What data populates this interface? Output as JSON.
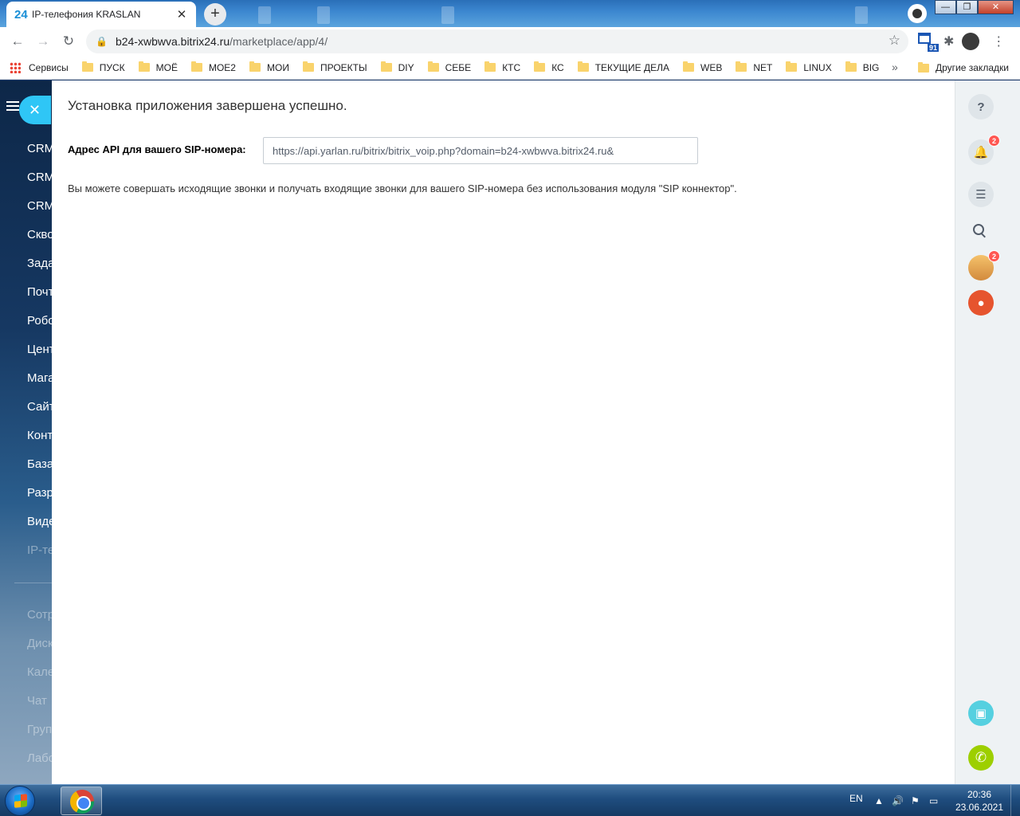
{
  "browser": {
    "tab": {
      "favicon": "24",
      "title": "IP-телефония KRASLAN",
      "close_glyph": "✕"
    },
    "new_tab_glyph": "+",
    "url_host": "b24-xwbwva.bitrix24.ru",
    "url_path": "/marketplace/app/4/",
    "extension_badge": "91",
    "window_controls": {
      "minimize": "—",
      "maximize": "❐",
      "close": "✕"
    }
  },
  "bookmarks": {
    "apps_label": "Сервисы",
    "items": [
      "ПУСК",
      "МОЁ",
      "МОЕ2",
      "МОИ",
      "ПРОЕКТЫ",
      "DIY",
      "СЕБЕ",
      "КТС",
      "КС",
      "ТЕКУЩИЕ ДЕЛА",
      "WEB",
      "NET",
      "LINUX",
      "BIG"
    ],
    "more_glyph": "»",
    "other": "Другие закладки"
  },
  "left_menu": {
    "close_glyph": "✕",
    "items": [
      "CRM",
      "CRM",
      "CRM",
      "Скво",
      "Зада",
      "Почт",
      "Робо",
      "Цент",
      "Мага",
      "Сайт",
      "Конт",
      "База",
      "Разр",
      "Виде",
      "IP-те"
    ],
    "items_lower": [
      "Сотр",
      "Диск",
      "Кале",
      "Чат",
      "Груп",
      "Лабо"
    ]
  },
  "app": {
    "title": "Установка приложения завершена успешно.",
    "api_label": "Адрес API для вашего SIP-номера:",
    "api_value": "https://api.yarlan.ru/bitrix/bitrix_voip.php?domain=b24-xwbwva.bitrix24.ru&",
    "info": "Вы можете совершать исходящие звонки и получать входящие звонки для вашего SIP-номера без использования модуля \"SIP коннектор\"."
  },
  "right_bar": {
    "help_glyph": "?",
    "notifications_count": "2",
    "avatar_count": "2"
  },
  "taskbar": {
    "lang": "EN",
    "time": "20:36",
    "date": "23.06.2021"
  },
  "icons": {
    "tab_close": "close-icon",
    "back": "arrow-left-icon",
    "forward": "arrow-right-icon",
    "reload": "reload-icon",
    "bookmark_star": "star-icon",
    "slider_close": "close-icon"
  }
}
